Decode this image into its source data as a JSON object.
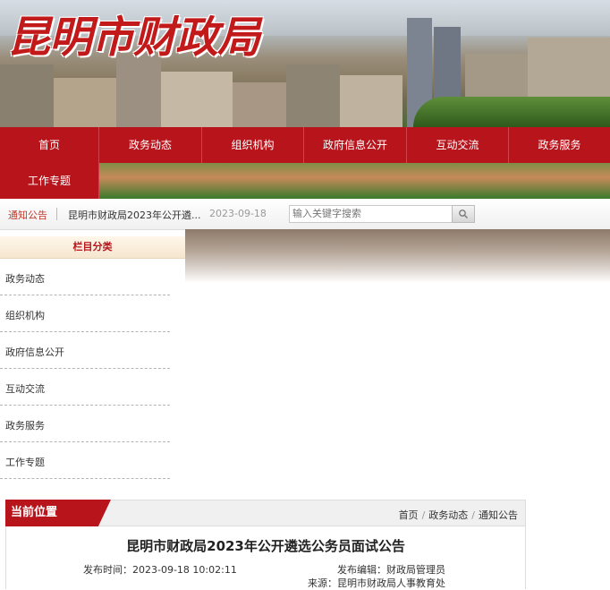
{
  "banner": {
    "title": "昆明市财政局"
  },
  "nav": {
    "items": [
      "首页",
      "政务动态",
      "组织机构",
      "政府信息公开",
      "互动交流",
      "政务服务",
      "工作专题"
    ]
  },
  "notice": {
    "label": "通知公告",
    "text": "昆明市财政局2023年公开遴...",
    "date": "2023-09-18"
  },
  "search": {
    "placeholder": "输入关键字搜索",
    "button_icon": "search-icon"
  },
  "sidebar": {
    "heading": "栏目分类",
    "items": [
      "政务动态",
      "组织机构",
      "政府信息公开",
      "互动交流",
      "政务服务",
      "工作专题"
    ]
  },
  "breadcrumb": {
    "title": "当前位置",
    "path": [
      "首页",
      "政务动态",
      "通知公告"
    ]
  },
  "article": {
    "title": "昆明市财政局2023年公开遴选公务员面试公告",
    "publish_label": "发布时间：",
    "publish_time": "2023-09-18 10:02:11",
    "editor_label": "发布编辑：",
    "editor": "财政局管理员",
    "source_label": "来源：",
    "source": "昆明市财政局人事教育处"
  },
  "colors": {
    "brand_red": "#b8141c"
  }
}
